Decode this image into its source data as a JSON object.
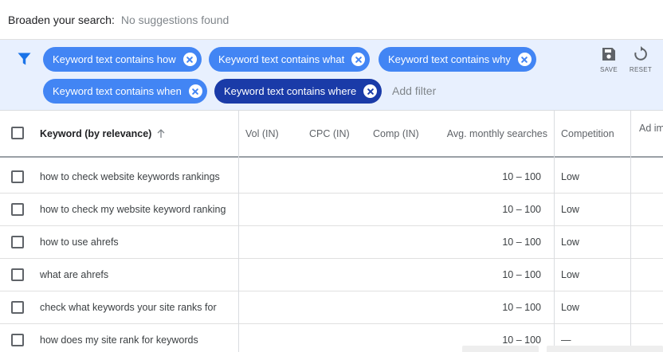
{
  "broaden": {
    "label": "Broaden your search:",
    "value": "No suggestions found"
  },
  "filters": {
    "chips": [
      {
        "label": "Keyword text contains how"
      },
      {
        "label": "Keyword text contains what"
      },
      {
        "label": "Keyword text contains why"
      },
      {
        "label": "Keyword text contains when"
      },
      {
        "label": "Keyword text contains where"
      }
    ],
    "add_filter": "Add filter",
    "save_label": "SAVE",
    "reset_label": "RESET",
    "icon": "filter-icon"
  },
  "table": {
    "headers": {
      "keyword": "Keyword (by relevance)",
      "vol": "Vol (IN)",
      "cpc": "CPC (IN)",
      "comp": "Comp (IN)",
      "ams": "Avg. monthly searches",
      "competition": "Competition",
      "ad": "Ad im"
    },
    "rows": [
      {
        "keyword": "how to check website keywords rankings",
        "ams": "10 – 100",
        "competition": "Low"
      },
      {
        "keyword": "how to check my website keyword ranking",
        "ams": "10 – 100",
        "competition": "Low"
      },
      {
        "keyword": "how to use ahrefs",
        "ams": "10 – 100",
        "competition": "Low"
      },
      {
        "keyword": "what are ahrefs",
        "ams": "10 – 100",
        "competition": "Low"
      },
      {
        "keyword": "check what keywords your site ranks for",
        "ams": "10 – 100",
        "competition": "Low"
      },
      {
        "keyword": "how does my site rank for keywords",
        "ams": "10 – 100",
        "competition": "—"
      }
    ]
  },
  "colors": {
    "chip": "#4285f4",
    "chip_active": "#1a3ba8",
    "filter_bg": "#e8f0fe"
  }
}
